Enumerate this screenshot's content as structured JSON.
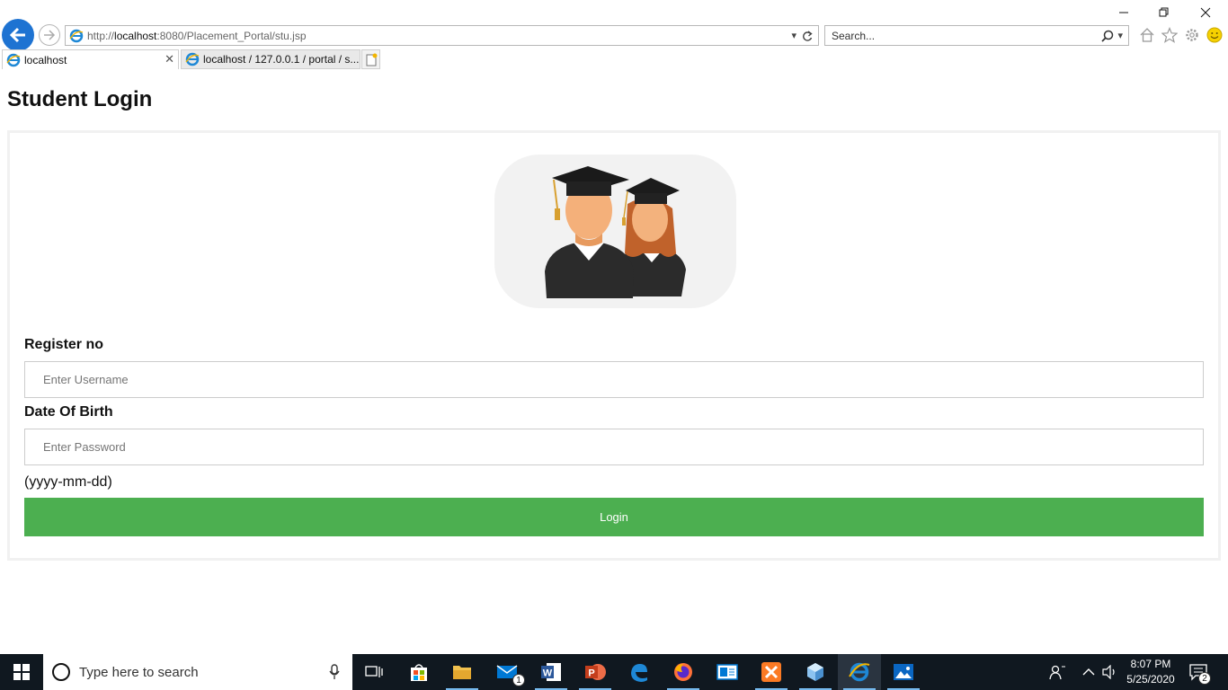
{
  "browser": {
    "url_prefix": "http://",
    "url_host": "localhost",
    "url_rest": ":8080/Placement_Portal/stu.jsp",
    "search_placeholder": "Search...",
    "tabs": [
      {
        "label": "localhost",
        "active": true
      },
      {
        "label": "localhost / 127.0.0.1 / portal / s...",
        "active": false
      }
    ]
  },
  "page": {
    "title": "Student Login",
    "register_label": "Register no",
    "register_placeholder": "Enter Username",
    "dob_label": "Date Of Birth",
    "dob_placeholder": "Enter Password",
    "dob_hint": "(yyyy-mm-dd)",
    "login_label": "Login"
  },
  "taskbar": {
    "search_placeholder": "Type here to search",
    "time": "8:07 PM",
    "date": "5/25/2020",
    "mail_badge": "1",
    "notification_badge": "2"
  },
  "colors": {
    "accent_green": "#4caf50",
    "back_button_blue": "#1e73d2",
    "taskbar_bg": "#101820"
  }
}
